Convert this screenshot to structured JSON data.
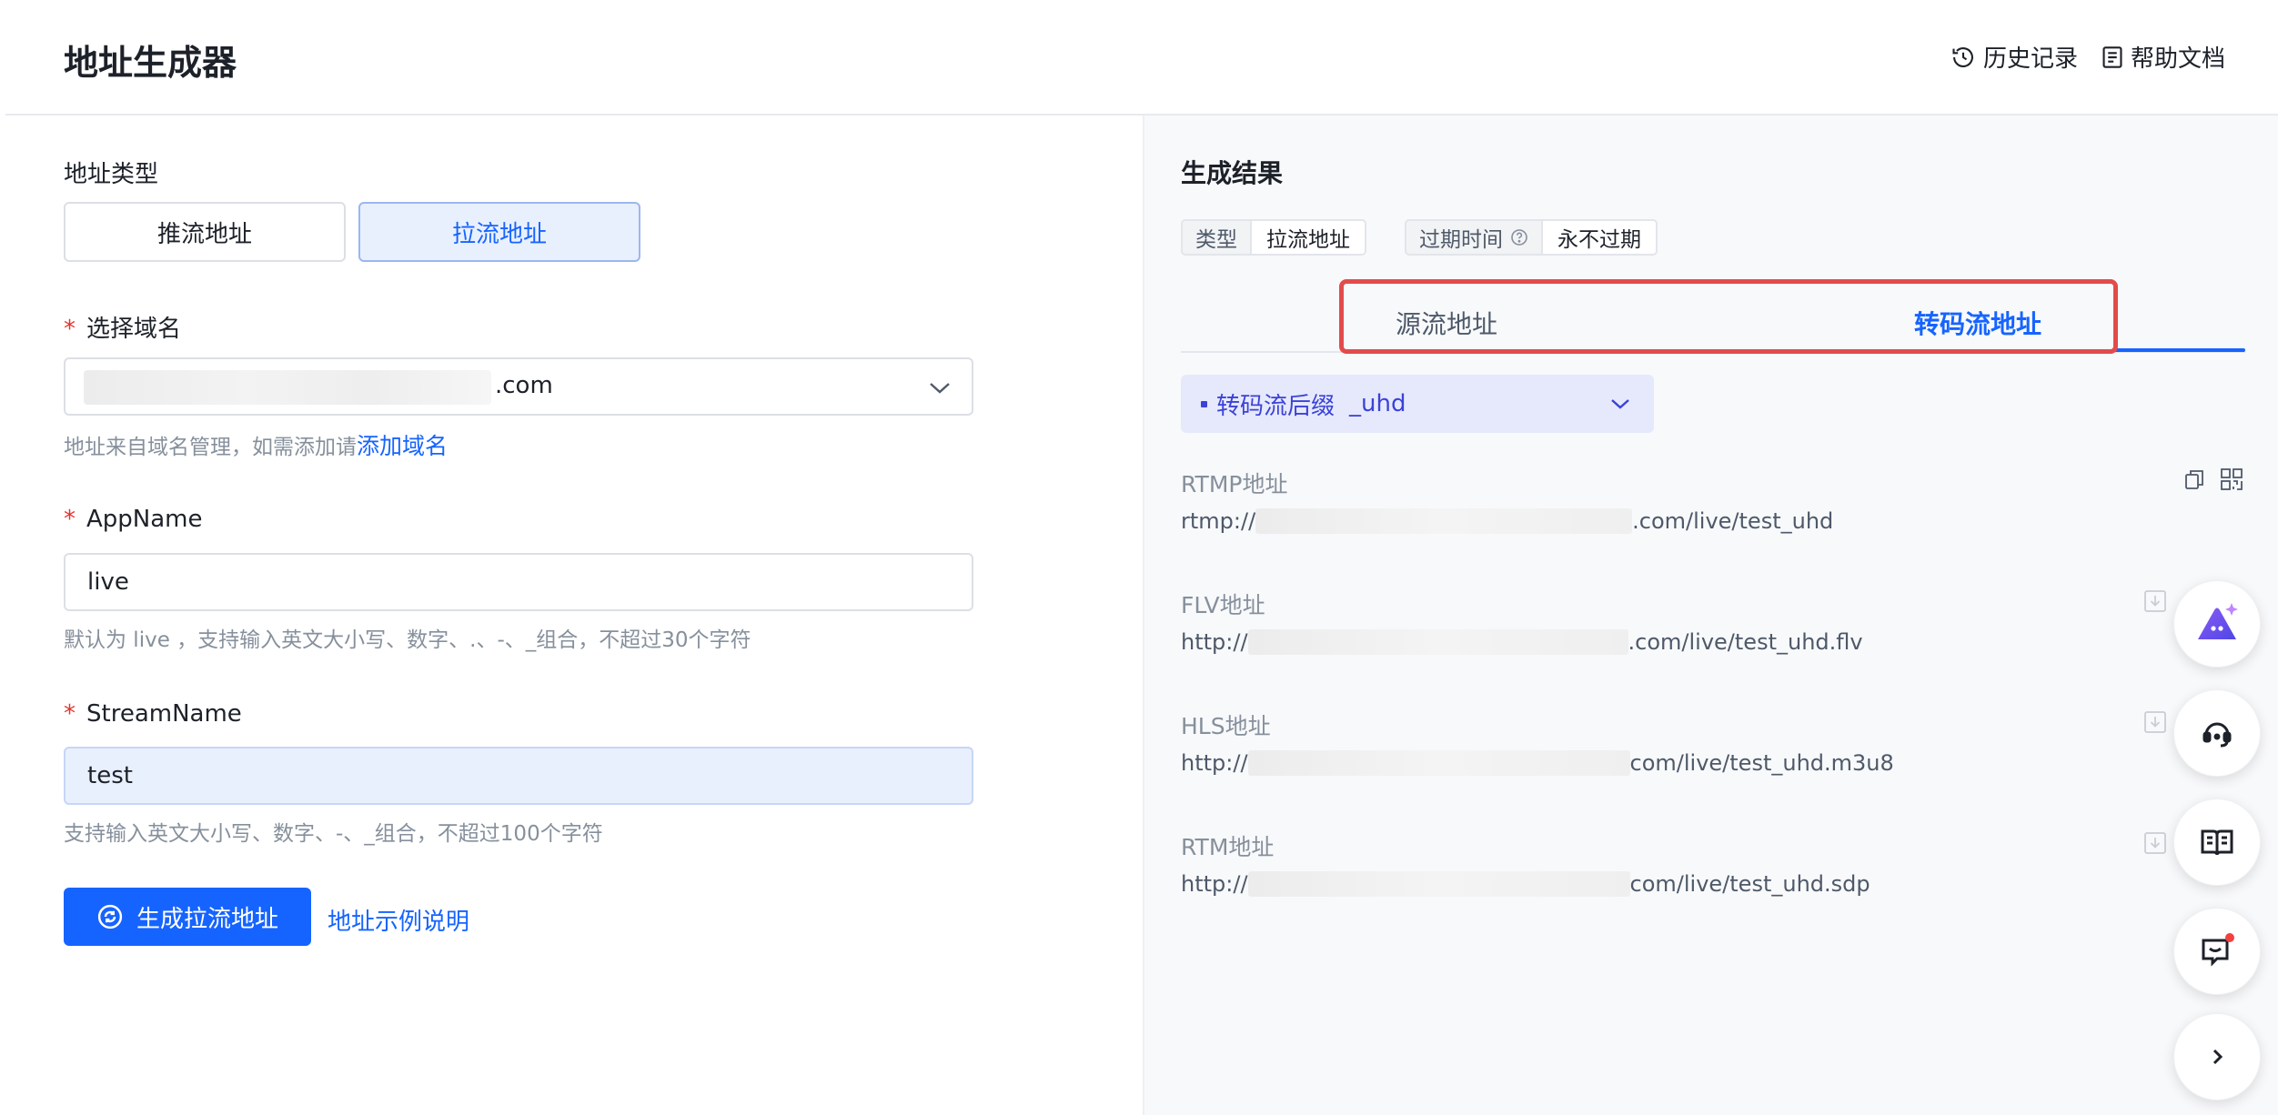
{
  "header": {
    "title": "地址生成器",
    "history_label": "历史记录",
    "help_label": "帮助文档"
  },
  "form": {
    "address_type": {
      "label": "地址类型",
      "options": [
        "推流地址",
        "拉流地址"
      ],
      "selected": "拉流地址"
    },
    "domain": {
      "label": "选择域名",
      "required_mark": "*",
      "value_suffix": ".com",
      "hint_prefix": "地址来自域名管理，如需添加请",
      "hint_link": "添加域名"
    },
    "app_name": {
      "label": "AppName",
      "required_mark": "*",
      "value": "live",
      "hint": "默认为 live ，支持输入英文大小写、数字、.、-、_组合，不超过30个字符"
    },
    "stream_name": {
      "label": "StreamName",
      "required_mark": "*",
      "value": "test",
      "hint": "支持输入英文大小写、数字、-、_组合，不超过100个字符"
    },
    "generate_button": "生成拉流地址",
    "example_link": "地址示例说明"
  },
  "result": {
    "title": "生成结果",
    "tags": [
      {
        "key": "类型",
        "value": "拉流地址"
      },
      {
        "key": "过期时间",
        "value": "永不过期",
        "has_help_icon": true
      }
    ],
    "tabs": [
      "源流地址",
      "转码流地址"
    ],
    "active_tab": "转码流地址",
    "suffix_select": {
      "label": "转码流后缀",
      "value": "_uhd"
    },
    "addresses": [
      {
        "label": "RTMP地址",
        "prefix": "rtmp://",
        "suffix": ".com/live/test_uhd"
      },
      {
        "label": "FLV地址",
        "prefix": "http://",
        "suffix": ".com/live/test_uhd.flv"
      },
      {
        "label": "HLS地址",
        "prefix": "http://",
        "suffix": "com/live/test_uhd.m3u8"
      },
      {
        "label": "RTM地址",
        "prefix": "http://",
        "suffix": "com/live/test_uhd.sdp"
      }
    ]
  },
  "colors": {
    "primary": "#1664ff",
    "highlight_box": "#e34b4b",
    "suffix_text": "#3b42d8"
  },
  "icons": [
    "history-icon",
    "document-icon",
    "chevron-down-icon",
    "refresh-icon",
    "help-circle-icon",
    "copy-icon",
    "qrcode-icon",
    "download-icon",
    "ai-assistant-icon",
    "headset-icon",
    "book-icon",
    "message-icon",
    "chevron-right-icon"
  ]
}
